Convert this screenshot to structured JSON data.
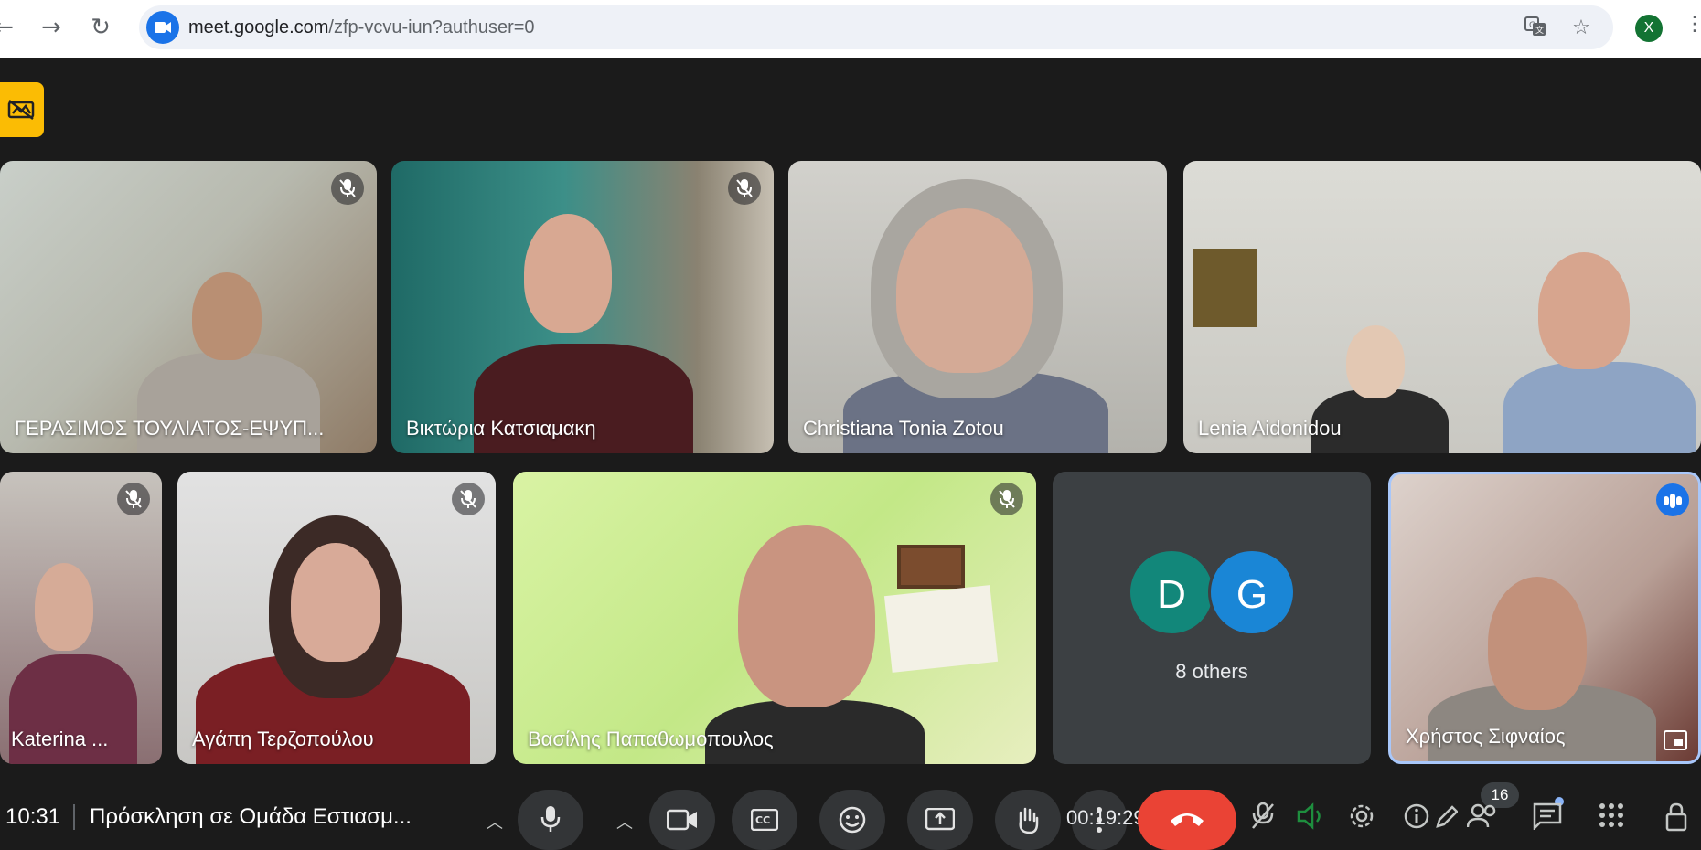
{
  "browser": {
    "url_host": "meet.google.com",
    "url_path": "/zfp-vcvu-iun?authuser=0",
    "profile_initial": "X"
  },
  "participants": [
    {
      "name": "ΓΕΡΑΣΙΜΟΣ ΤΟΥΛΙΑΤΟΣ-ΕΨΥΠ...",
      "muted": true
    },
    {
      "name": "Βικτώρια Κατσιαμακη",
      "muted": true
    },
    {
      "name": "Christiana Tonia Zotou",
      "muted": false
    },
    {
      "name": "Lenia Aidonidou",
      "muted": false
    },
    {
      "name": "Katerina ...",
      "muted": true
    },
    {
      "name": "Αγάπη Τερζοπούλου",
      "muted": true
    },
    {
      "name": "Βασίλης Παπαθωμοπουλος",
      "muted": true
    },
    {
      "name": "Χρήστος Σιφναίος",
      "muted": false,
      "speaking": true
    }
  ],
  "others_tile": {
    "avatars": [
      {
        "initial": "D",
        "color": "#12877a"
      },
      {
        "initial": "G",
        "color": "#1a86d6"
      }
    ],
    "label": "8 others"
  },
  "controls": {
    "time": "10:31",
    "meeting_title": "Πρόσκληση σε Ομάδα Εστιασμ...",
    "timer": "00:19:29",
    "participant_count": "16"
  },
  "colors": {
    "end_call": "#ea4335",
    "recording_badge": "#fbbc04",
    "speaking_border": "#a8c7fa"
  }
}
